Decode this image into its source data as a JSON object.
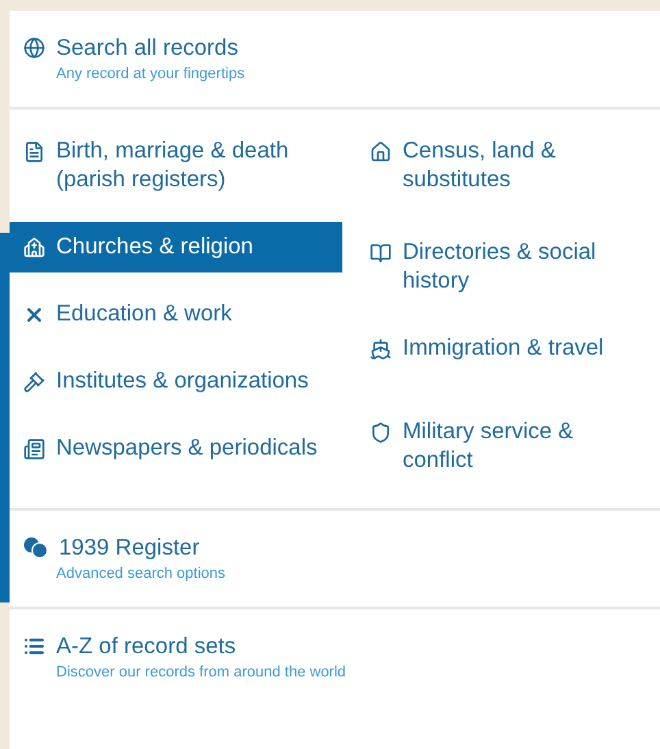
{
  "search_all": {
    "title": "Search all records",
    "subtitle": "Any record at your fingertips"
  },
  "categories": {
    "left_column": [
      {
        "kind": "document",
        "label": "Birth, marriage & death (parish registers)",
        "selected": false
      },
      {
        "kind": "church",
        "label": "Churches & religion",
        "selected": true
      },
      {
        "kind": "tools",
        "label": "Education & work",
        "selected": false
      },
      {
        "kind": "gavel",
        "label": "Institutes & organizations",
        "selected": false
      },
      {
        "kind": "newspaper",
        "label": "Newspapers & periodicals",
        "selected": false
      }
    ],
    "right_column": [
      {
        "kind": "house",
        "label": "Census, land & substitutes",
        "selected": false
      },
      {
        "kind": "book",
        "label": "Directories & social history",
        "selected": false
      },
      {
        "kind": "ship",
        "label": "Immigration & travel",
        "selected": false
      },
      {
        "kind": "medal",
        "label": "Military service & conflict",
        "selected": false
      }
    ]
  },
  "register": {
    "title": "1939 Register",
    "subtitle": "Advanced search options"
  },
  "a_z": {
    "title": "A-Z of record sets",
    "subtitle": "Discover our records from around the world"
  }
}
